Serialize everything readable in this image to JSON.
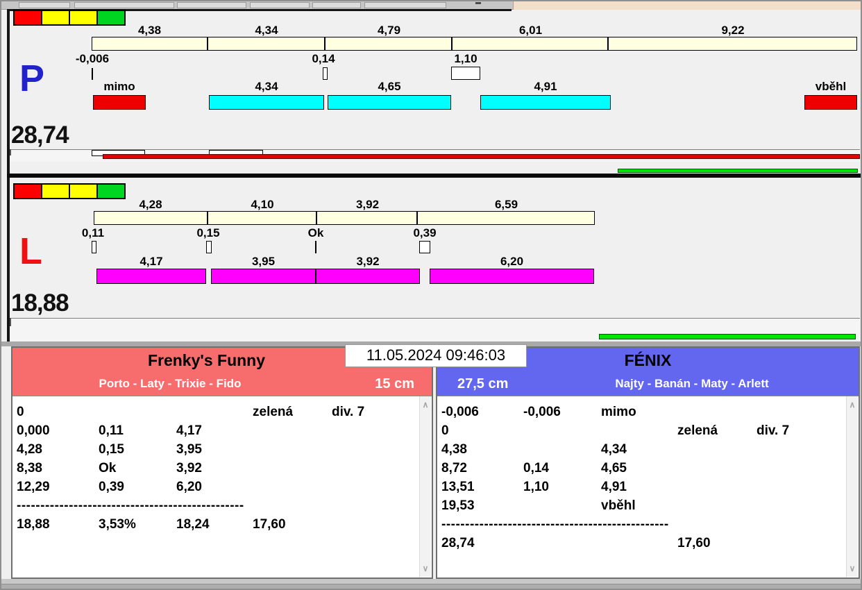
{
  "datetime": "11.05.2024 09:46:03",
  "p": {
    "lane": "P",
    "total": "28,74",
    "seg_labels": [
      "4,38",
      "4,34",
      "4,79",
      "6,01",
      "9,22"
    ],
    "tick_labels": [
      "-0,006",
      "0,14",
      "1,10"
    ],
    "bar_labels": [
      "mimo",
      "4,34",
      "4,65",
      "4,91",
      "vběhl"
    ]
  },
  "l": {
    "lane": "L",
    "total": "18,88",
    "seg_labels": [
      "4,28",
      "4,10",
      "3,92",
      "6,59"
    ],
    "tick_labels": [
      "0,11",
      "0,15",
      "Ok",
      "0,39"
    ],
    "bar_labels": [
      "4,17",
      "3,95",
      "3,92",
      "6,20"
    ]
  },
  "left_team": {
    "name": "Frenky's Funny",
    "dogs": "Porto - Laty - Trixie - Fido",
    "height": "15 cm",
    "rows": [
      [
        "0",
        "",
        "",
        "zelená",
        "div. 7"
      ],
      [
        "0,000",
        "0,11",
        "4,17",
        "",
        ""
      ],
      [
        "4,28",
        "0,15",
        "3,95",
        "",
        ""
      ],
      [
        "8,38",
        "Ok",
        "3,92",
        "",
        ""
      ],
      [
        "12,29",
        "0,39",
        "6,20",
        "",
        ""
      ]
    ],
    "separator": "------------------------------------------------",
    "total_row": [
      "18,88",
      "3,53%",
      "18,24",
      "17,60",
      ""
    ]
  },
  "right_team": {
    "name": "FÉNIX",
    "dogs": "Najty - Banán - Maty - Arlett",
    "height": "27,5 cm",
    "rows": [
      [
        "-0,006",
        "-0,006",
        "mimo",
        "",
        ""
      ],
      [
        "0",
        "",
        "",
        "zelená",
        "div. 7"
      ],
      [
        "4,38",
        "",
        "4,34",
        "",
        ""
      ],
      [
        "8,72",
        "0,14",
        "4,65",
        "",
        ""
      ],
      [
        "13,51",
        "1,10",
        "4,91",
        "",
        ""
      ],
      [
        "19,53",
        "",
        "vběhl",
        "",
        ""
      ]
    ],
    "separator": "------------------------------------------------",
    "total_row": [
      "28,74",
      "",
      "",
      "17,60",
      ""
    ]
  },
  "icons": {
    "scroll_up": "∧",
    "scroll_down": "∨"
  },
  "colors": {
    "team_left_bg": "#F76C6C",
    "team_right_bg": "#6366EF",
    "lane_p_letter": "#2222CC",
    "lane_l_letter": "#EE1111",
    "segment_bar": "#FFFFE1",
    "p_dog_bar": "#00FFFF",
    "l_dog_bar": "#FF00FF",
    "fault_bar": "#EE0000",
    "ok_green": "#00D522"
  }
}
